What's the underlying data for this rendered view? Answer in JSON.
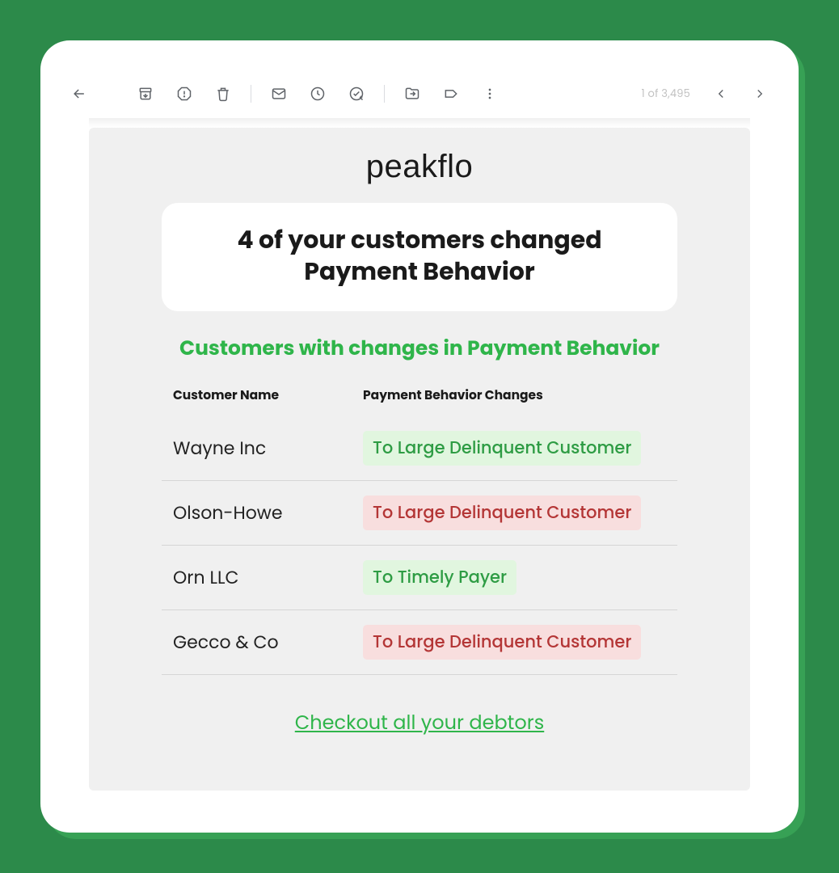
{
  "toolbar": {
    "count_label": "1 of 3,495",
    "icons": {
      "back": "back-arrow-icon",
      "archive": "archive-icon",
      "spam": "report-spam-icon",
      "delete": "delete-icon",
      "unread": "mark-unread-icon",
      "snooze": "snooze-icon",
      "task": "add-task-icon",
      "move": "move-to-icon",
      "labels": "labels-icon",
      "more": "more-icon",
      "prev": "prev-icon",
      "next": "next-icon"
    }
  },
  "email": {
    "brand": "peakflo",
    "headline": "4 of your customers changed Payment Behavior",
    "subhead": "Customers with changes in Payment Behavior",
    "columns": {
      "name": "Customer Name",
      "change": "Payment Behavior Changes"
    },
    "rows": [
      {
        "name": "Wayne Inc",
        "change": "To Large Delinquent Customer",
        "tone": "positive"
      },
      {
        "name": "Olson-Howe",
        "change": "To Large Delinquent Customer",
        "tone": "negative"
      },
      {
        "name": "Orn LLC",
        "change": "To Timely Payer",
        "tone": "positive"
      },
      {
        "name": "Gecco & Co",
        "change": "To Large Delinquent Customer",
        "tone": "negative"
      }
    ],
    "footer_link": "Checkout all your debtors"
  },
  "colors": {
    "accent_green": "#2fb54a",
    "badge_positive_bg": "#e1f6df",
    "badge_positive_fg": "#2e9c44",
    "badge_negative_bg": "#f8dede",
    "badge_negative_fg": "#b43636"
  }
}
